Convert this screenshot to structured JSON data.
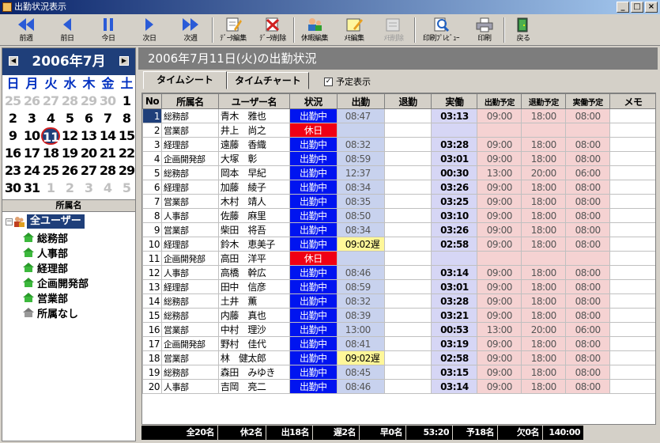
{
  "window": {
    "title": "出勤状況表示"
  },
  "toolbar": [
    {
      "label": "前週",
      "icon": "double-left-arrow-icon"
    },
    {
      "label": "前日",
      "icon": "left-arrow-icon"
    },
    {
      "label": "今日",
      "icon": "pause-icon"
    },
    {
      "label": "次日",
      "icon": "right-arrow-icon"
    },
    {
      "label": "次週",
      "icon": "double-right-arrow-icon"
    },
    {
      "label": "ﾃﾞｰﾀ編集",
      "icon": "edit-data-icon"
    },
    {
      "label": "ﾃﾞｰﾀ削除",
      "icon": "delete-data-icon"
    },
    {
      "label": "休暇編集",
      "icon": "vacation-edit-icon"
    },
    {
      "label": "ﾒﾓ編集",
      "icon": "memo-edit-icon"
    },
    {
      "label": "ﾒﾓ削除",
      "icon": "memo-delete-icon"
    },
    {
      "label": "印刷ﾌﾟﾚﾋﾞｭｰ",
      "icon": "print-preview-icon"
    },
    {
      "label": "印刷",
      "icon": "printer-icon"
    },
    {
      "label": "戻る",
      "icon": "exit-door-icon"
    }
  ],
  "calendar": {
    "month_title": "2006年7月",
    "weekdays": [
      "日",
      "月",
      "火",
      "水",
      "木",
      "金",
      "土"
    ],
    "days": [
      [
        "25",
        "26",
        "27",
        "28",
        "29",
        "30",
        "1"
      ],
      [
        "2",
        "3",
        "4",
        "5",
        "6",
        "7",
        "8"
      ],
      [
        "9",
        "10",
        "11",
        "12",
        "13",
        "14",
        "15"
      ],
      [
        "16",
        "17",
        "18",
        "19",
        "20",
        "21",
        "22"
      ],
      [
        "23",
        "24",
        "25",
        "26",
        "27",
        "28",
        "29"
      ],
      [
        "30",
        "31",
        "1",
        "2",
        "3",
        "4",
        "5"
      ]
    ],
    "selected_day": "11"
  },
  "groups": {
    "header": "所属名",
    "root": "全ユーザー",
    "items": [
      "総務部",
      "人事部",
      "経理部",
      "企画開発部",
      "営業部",
      "所属なし"
    ]
  },
  "main": {
    "title": "2006年7月11日(火)の出勤状況",
    "tabs": [
      "タイムシート",
      "タイムチャート"
    ],
    "checkbox_label": "予定表示",
    "columns": [
      "No",
      "所属名",
      "ユーザー名",
      "状況",
      "出勤",
      "退勤",
      "実働",
      "出勤予定",
      "退勤予定",
      "実働予定",
      "メモ"
    ],
    "rows": [
      [
        "1",
        "総務部",
        "青木　雅也",
        "出勤中",
        "08:47",
        "",
        "03:13",
        "09:00",
        "18:00",
        "08:00",
        ""
      ],
      [
        "2",
        "営業部",
        "井上　尚之",
        "休日",
        "",
        "",
        "",
        "",
        "",
        "",
        ""
      ],
      [
        "3",
        "経理部",
        "遠藤　香織",
        "出勤中",
        "08:32",
        "",
        "03:28",
        "09:00",
        "18:00",
        "08:00",
        ""
      ],
      [
        "4",
        "企画開発部",
        "大塚　彰",
        "出勤中",
        "08:59",
        "",
        "03:01",
        "09:00",
        "18:00",
        "08:00",
        ""
      ],
      [
        "5",
        "総務部",
        "岡本　早紀",
        "出勤中",
        "12:37",
        "",
        "00:30",
        "13:00",
        "20:00",
        "06:00",
        ""
      ],
      [
        "6",
        "経理部",
        "加藤　綾子",
        "出勤中",
        "08:34",
        "",
        "03:26",
        "09:00",
        "18:00",
        "08:00",
        ""
      ],
      [
        "7",
        "営業部",
        "木村　靖人",
        "出勤中",
        "08:35",
        "",
        "03:25",
        "09:00",
        "18:00",
        "08:00",
        ""
      ],
      [
        "8",
        "人事部",
        "佐藤　麻里",
        "出勤中",
        "08:50",
        "",
        "03:10",
        "09:00",
        "18:00",
        "08:00",
        ""
      ],
      [
        "9",
        "営業部",
        "柴田　将吾",
        "出勤中",
        "08:34",
        "",
        "03:26",
        "09:00",
        "18:00",
        "08:00",
        ""
      ],
      [
        "10",
        "経理部",
        "鈴木　恵美子",
        "出勤中",
        "09:02遅",
        "",
        "02:58",
        "09:00",
        "18:00",
        "08:00",
        ""
      ],
      [
        "11",
        "企画開発部",
        "高田　洋平",
        "休日",
        "",
        "",
        "",
        "",
        "",
        "",
        ""
      ],
      [
        "12",
        "人事部",
        "高橋　幹広",
        "出勤中",
        "08:46",
        "",
        "03:14",
        "09:00",
        "18:00",
        "08:00",
        ""
      ],
      [
        "13",
        "経理部",
        "田中　信彦",
        "出勤中",
        "08:59",
        "",
        "03:01",
        "09:00",
        "18:00",
        "08:00",
        ""
      ],
      [
        "14",
        "総務部",
        "土井　薫",
        "出勤中",
        "08:32",
        "",
        "03:28",
        "09:00",
        "18:00",
        "08:00",
        ""
      ],
      [
        "15",
        "総務部",
        "内藤　真也",
        "出勤中",
        "08:39",
        "",
        "03:21",
        "09:00",
        "18:00",
        "08:00",
        ""
      ],
      [
        "16",
        "営業部",
        "中村　理沙",
        "出勤中",
        "13:00",
        "",
        "00:53",
        "13:00",
        "20:00",
        "06:00",
        ""
      ],
      [
        "17",
        "企画開発部",
        "野村　佳代",
        "出勤中",
        "08:41",
        "",
        "03:19",
        "09:00",
        "18:00",
        "08:00",
        ""
      ],
      [
        "18",
        "営業部",
        "林　健太郎",
        "出勤中",
        "09:02遅",
        "",
        "02:58",
        "09:00",
        "18:00",
        "08:00",
        ""
      ],
      [
        "19",
        "総務部",
        "森田　みゆき",
        "出勤中",
        "08:45",
        "",
        "03:15",
        "09:00",
        "18:00",
        "08:00",
        ""
      ],
      [
        "20",
        "人事部",
        "吉岡　亮二",
        "出勤中",
        "08:46",
        "",
        "03:14",
        "09:00",
        "18:00",
        "08:00",
        ""
      ]
    ],
    "footer": [
      "全20名",
      "休2名",
      "出18名",
      "遅2名",
      "早0名",
      "53:20",
      "予18名",
      "欠0名",
      "140:00"
    ]
  },
  "colors": {
    "working": "#0014f0",
    "holiday": "#f00014",
    "late": "#fff799",
    "selection": "#1f3f7a"
  }
}
